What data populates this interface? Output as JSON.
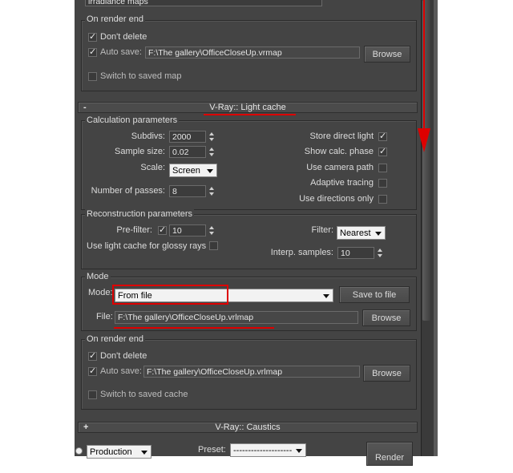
{
  "top_field_value": "irradiance maps",
  "render_end_1": {
    "title": "On render end",
    "dont_delete": {
      "label": "Don't delete",
      "checked": true
    },
    "auto_save": {
      "label": "Auto save:",
      "checked": true,
      "path": "F:\\The gallery\\OfficeCloseUp.vrmap"
    },
    "browse_label": "Browse",
    "switch": {
      "label": "Switch to saved map",
      "checked": false
    }
  },
  "light_cache": {
    "rollout_title": "V-Ray:: Light cache",
    "rollout_toggle": "-",
    "calc": {
      "title": "Calculation parameters",
      "subdivs": {
        "label": "Subdivs:",
        "value": "2000"
      },
      "sample_size": {
        "label": "Sample size:",
        "value": "0.02"
      },
      "scale": {
        "label": "Scale:",
        "value": "Screen"
      },
      "passes": {
        "label": "Number of passes:",
        "value": "8"
      },
      "store_direct": {
        "label": "Store direct light",
        "checked": true
      },
      "show_calc": {
        "label": "Show calc. phase",
        "checked": true
      },
      "camera_path": {
        "label": "Use camera path",
        "checked": false
      },
      "adaptive": {
        "label": "Adaptive tracing",
        "checked": false
      },
      "directions": {
        "label": "Use directions only",
        "checked": false
      }
    },
    "recon": {
      "title": "Reconstruction parameters",
      "prefilter": {
        "label": "Pre-filter:",
        "checked": true,
        "value": "10"
      },
      "glossy": {
        "label": "Use light cache for glossy rays",
        "checked": false
      },
      "filter": {
        "label": "Filter:",
        "value": "Nearest"
      },
      "interp": {
        "label": "Interp. samples:",
        "value": "10"
      }
    },
    "mode": {
      "title": "Mode",
      "mode_label": "Mode:",
      "mode_value": "From file",
      "save_to_file": "Save to file",
      "file_label": "File:",
      "file_value": "F:\\The gallery\\OfficeCloseUp.vrlmap",
      "browse_label": "Browse"
    },
    "render_end": {
      "title": "On render end",
      "dont_delete": {
        "label": "Don't delete",
        "checked": true
      },
      "auto_save": {
        "label": "Auto save:",
        "checked": true,
        "path": "F:\\The gallery\\OfficeCloseUp.vrlmap"
      },
      "browse_label": "Browse",
      "switch": {
        "label": "Switch to saved cache",
        "checked": false
      }
    }
  },
  "caustics": {
    "rollout_title": "V-Ray:: Caustics",
    "rollout_toggle": "+"
  },
  "bottom": {
    "mode_value": "Production",
    "preset_label": "Preset:",
    "preset_value": "--------------------",
    "render_button": "Render"
  },
  "annotation_color": "#dd0000"
}
